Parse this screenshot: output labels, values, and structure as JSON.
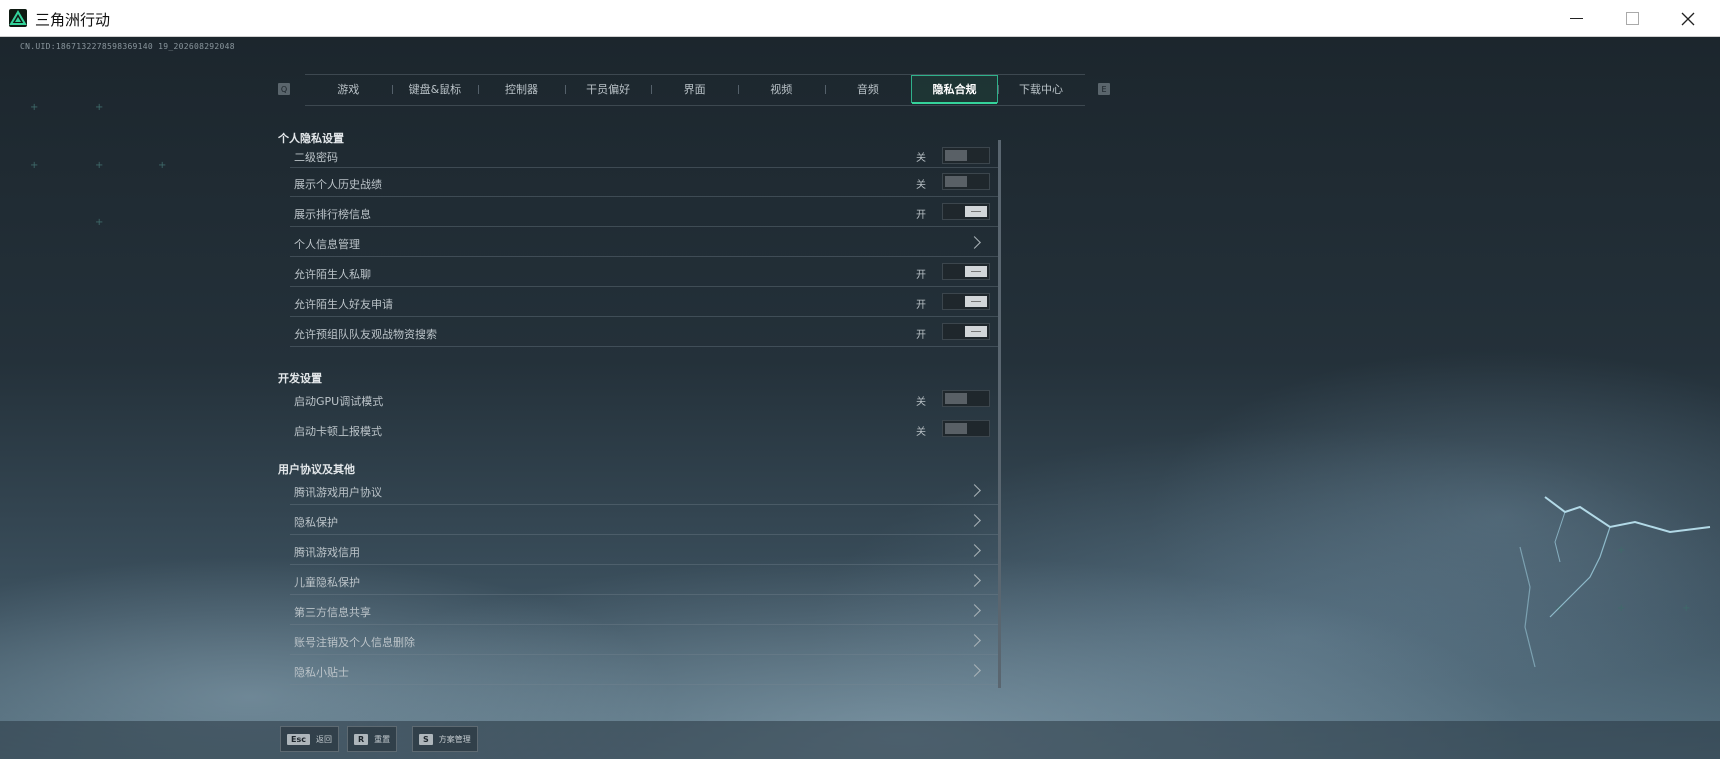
{
  "window": {
    "title": "三角洲行动",
    "icons": [
      "app-logo-icon",
      "minimize-icon",
      "maximize-icon",
      "close-icon"
    ]
  },
  "game": {
    "uid": "CN.UID:1867132278598369140 19_202608292048",
    "tabs": [
      {
        "label": "游戏",
        "active": false
      },
      {
        "label": "键盘&鼠标",
        "active": false
      },
      {
        "label": "控制器",
        "active": false
      },
      {
        "label": "干员偏好",
        "active": false
      },
      {
        "label": "界面",
        "active": false
      },
      {
        "label": "视频",
        "active": false
      },
      {
        "label": "音频",
        "active": false
      },
      {
        "label": "隐私合规",
        "active": true
      },
      {
        "label": "下载中心",
        "active": false
      }
    ],
    "tab_key_left": "Q",
    "tab_key_right": "E",
    "sections": [
      {
        "title": "个人隐私设置",
        "rows": [
          {
            "label": "二级密码",
            "state": "关",
            "type": "toggle",
            "on": false
          },
          {
            "label": "展示个人历史战绩",
            "state": "关",
            "type": "toggle",
            "on": false
          },
          {
            "label": "展示排行榜信息",
            "state": "开",
            "type": "toggle",
            "on": true
          },
          {
            "label": "个人信息管理",
            "state": "",
            "type": "link"
          },
          {
            "label": "允许陌生人私聊",
            "state": "开",
            "type": "toggle",
            "on": true
          },
          {
            "label": "允许陌生人好友申请",
            "state": "开",
            "type": "toggle",
            "on": true
          },
          {
            "label": "允许预组队队友观战物资搜索",
            "state": "开",
            "type": "toggle",
            "on": true
          }
        ]
      },
      {
        "title": "开发设置",
        "rows": [
          {
            "label": "启动GPU调试模式",
            "state": "关",
            "type": "toggle",
            "on": false
          },
          {
            "label": "启动卡顿上报模式",
            "state": "关",
            "type": "toggle",
            "on": false
          }
        ]
      },
      {
        "title": "用户协议及其他",
        "rows": [
          {
            "label": "腾讯游戏用户协议",
            "type": "link"
          },
          {
            "label": "隐私保护",
            "type": "link"
          },
          {
            "label": "腾讯游戏信用",
            "type": "link"
          },
          {
            "label": "儿童隐私保护",
            "type": "link"
          },
          {
            "label": "第三方信息共享",
            "type": "link"
          },
          {
            "label": "账号注销及个人信息删除",
            "type": "link"
          },
          {
            "label": "隐私小贴士",
            "type": "link"
          }
        ]
      }
    ],
    "bottom_hints": [
      {
        "key": "Esc",
        "label": "返回"
      },
      {
        "key": "R",
        "label": "重置"
      },
      {
        "key": "S",
        "label": "方案管理"
      }
    ],
    "accent_color": "#35d39b"
  }
}
